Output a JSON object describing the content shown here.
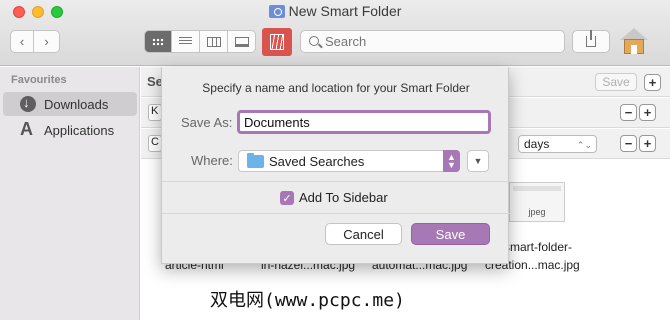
{
  "window": {
    "title": "New Smart Folder",
    "search_placeholder": "Search"
  },
  "toolbar": {
    "back_glyph": "‹",
    "forward_glyph": "›",
    "view_modes": [
      "icon-view",
      "list-view",
      "column-view",
      "gallery-view"
    ],
    "active_view": "icon-view"
  },
  "sidebar": {
    "heading": "Favourites",
    "items": [
      {
        "label": "Downloads",
        "icon": "download-icon",
        "active": true
      },
      {
        "label": "Applications",
        "icon": "applications-icon",
        "active": false
      }
    ]
  },
  "main": {
    "criteria_label": "Se",
    "top_save_label": "Save",
    "row1_stub": "K",
    "row2_stub": "C",
    "days_label": "days",
    "thumb_caption": "jpeg",
    "file_captions": [
      "article-html",
      "in-hazel...mac.jpg",
      "automat...mac.jpg",
      "smart-folder-",
      "creation...mac.jpg"
    ]
  },
  "sheet": {
    "prompt": "Specify a name and location for your Smart Folder",
    "save_as_label": "Save As:",
    "save_as_value": "Documents",
    "where_label": "Where:",
    "where_value": "Saved Searches",
    "add_to_sidebar_label": "Add To Sidebar",
    "add_to_sidebar_checked": true,
    "cancel_label": "Cancel",
    "save_label": "Save"
  },
  "watermark": "双电网(www.pcpc.me)",
  "colors": {
    "accent": "#a877b6",
    "arrange_button": "#d9534f"
  }
}
